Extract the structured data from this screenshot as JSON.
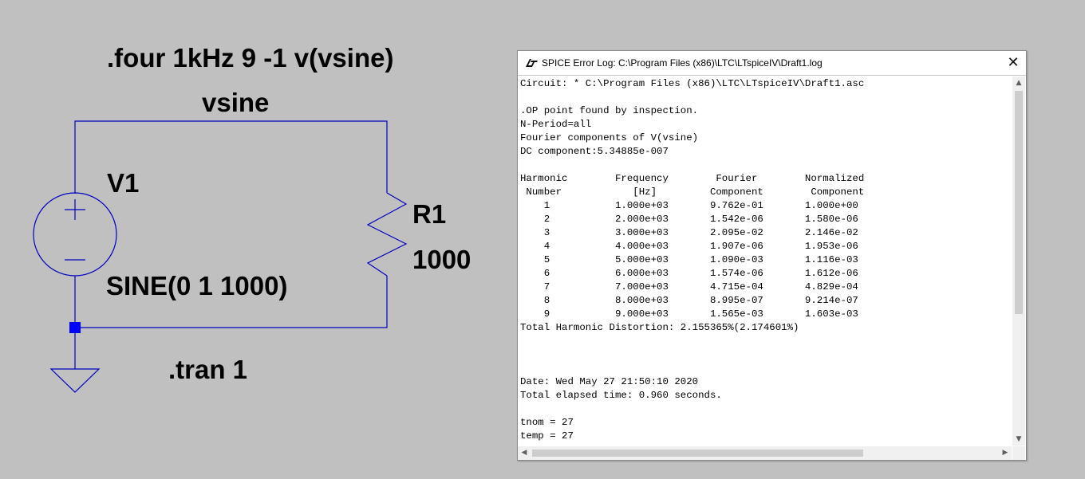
{
  "schematic": {
    "four_directive": ".four 1kHz 9 -1 v(vsine)",
    "net_label": "vsine",
    "source_name": "V1",
    "source_value": "SINE(0 1 1000)",
    "resistor_name": "R1",
    "resistor_value": "1000",
    "tran_directive": ".tran 1",
    "wire_color": "#0000c0",
    "junction_color": "#0000ff"
  },
  "log_window": {
    "title": "SPICE Error Log: C:\\Program Files (x86)\\LTC\\LTspiceIV\\Draft1.log",
    "close_glyph": "✕",
    "lines": [
      "Circuit: * C:\\Program Files (x86)\\LTC\\LTspiceIV\\Draft1.asc",
      "",
      ".OP point found by inspection.",
      "N-Period=all",
      "Fourier components of V(vsine)",
      "DC component:5.34885e-007",
      "",
      "Harmonic        Frequency        Fourier        Normalized",
      " Number            [Hz]         Component        Component",
      "    1           1.000e+03       9.762e-01       1.000e+00",
      "    2           2.000e+03       1.542e-06       1.580e-06",
      "    3           3.000e+03       2.095e-02       2.146e-02",
      "    4           4.000e+03       1.907e-06       1.953e-06",
      "    5           5.000e+03       1.090e-03       1.116e-03",
      "    6           6.000e+03       1.574e-06       1.612e-06",
      "    7           7.000e+03       4.715e-04       4.829e-04",
      "    8           8.000e+03       8.995e-07       9.214e-07",
      "    9           9.000e+03       1.565e-03       1.603e-03",
      "Total Harmonic Distortion: 2.155365%(2.174601%)",
      "",
      "",
      "",
      "Date: Wed May 27 21:50:10 2020",
      "Total elapsed time: 0.960 seconds.",
      "",
      "tnom = 27",
      "temp = 27"
    ]
  }
}
